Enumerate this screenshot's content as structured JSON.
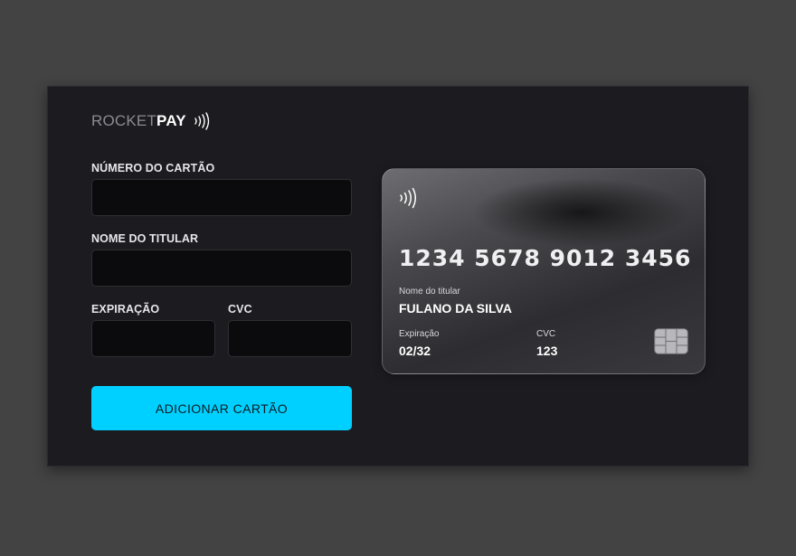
{
  "brand": {
    "part1": "ROCKET",
    "part2": "PAY"
  },
  "form": {
    "card_number_label": "NÚMERO DO CARTÃO",
    "card_number_value": "",
    "holder_label": "NOME DO TITULAR",
    "holder_value": "",
    "expiry_label": "EXPIRAÇÃO",
    "expiry_value": "",
    "cvc_label": "CVC",
    "cvc_value": "",
    "submit_label": "ADICIONAR CARTÃO"
  },
  "card": {
    "number": "1234 5678 9012 3456",
    "holder_label": "Nome do titular",
    "holder_name": "FULANO DA SILVA",
    "expiry_label": "Expiração",
    "expiry_value": "02/32",
    "cvc_label": "CVC",
    "cvc_value": "123"
  },
  "colors": {
    "background": "#434343",
    "panel": "#1c1c20",
    "input": "#0b0b0d",
    "accent": "#00d0ff"
  },
  "icons": {
    "contactless": "contactless-icon",
    "chip": "card-chip-icon"
  }
}
